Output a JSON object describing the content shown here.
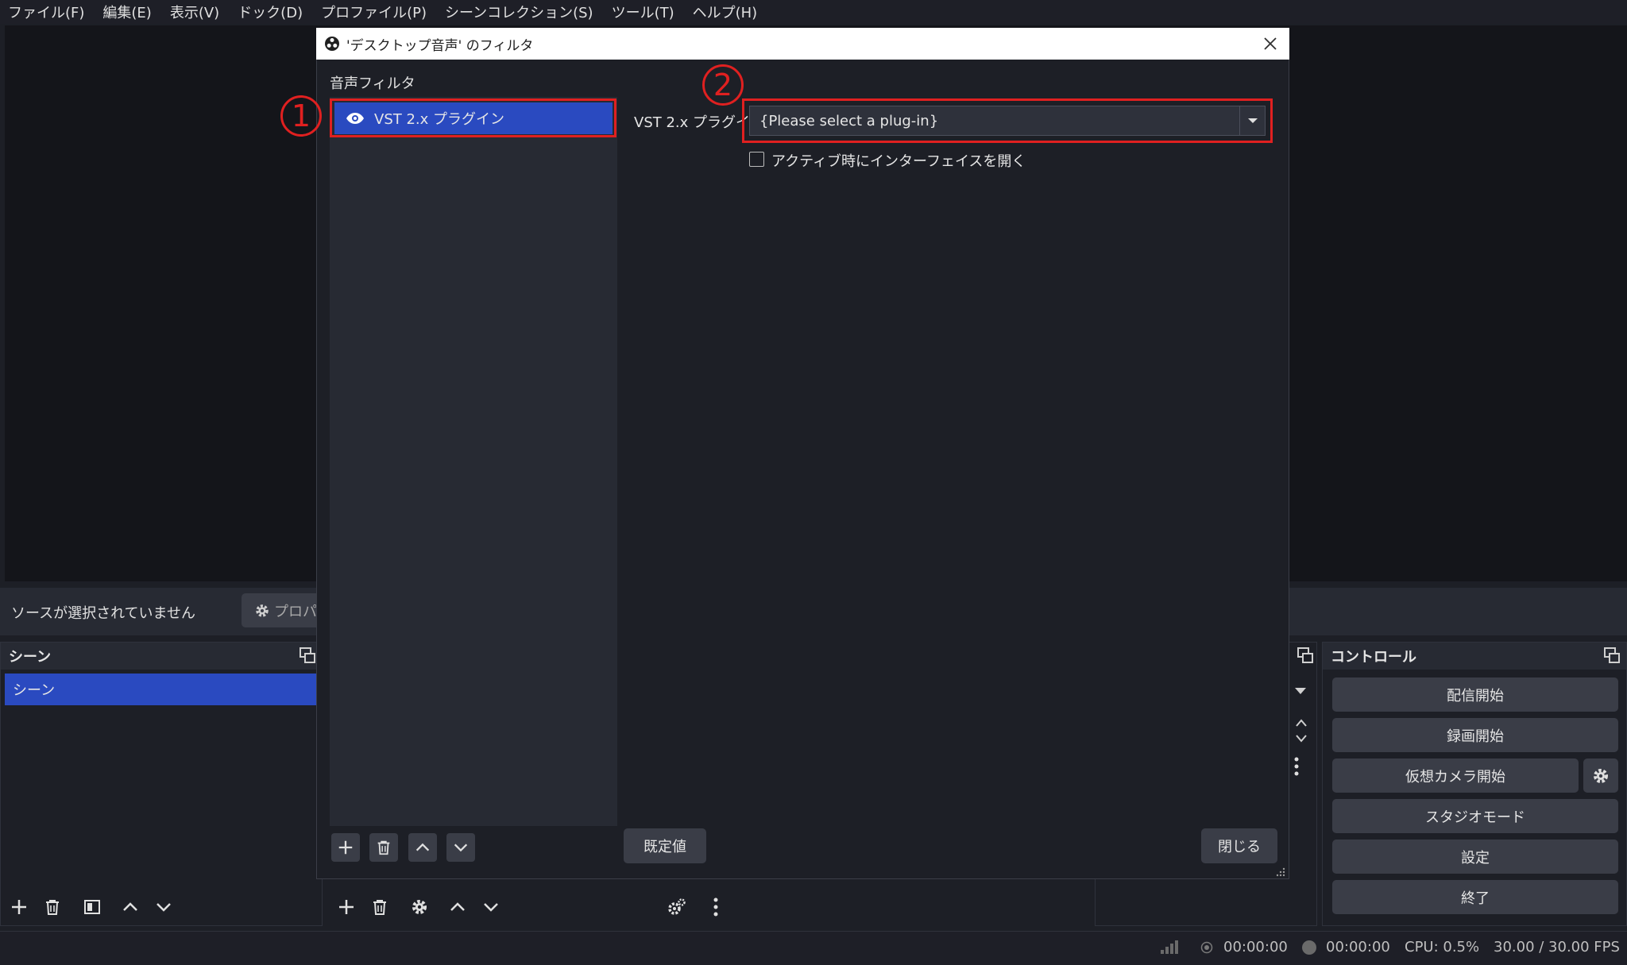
{
  "menubar": {
    "items": [
      "ファイル(F)",
      "編集(E)",
      "表示(V)",
      "ドック(D)",
      "プロファイル(P)",
      "シーンコレクション(S)",
      "ツール(T)",
      "ヘルプ(H)"
    ]
  },
  "source_bar": {
    "no_source": "ソースが選択されていません",
    "properties": "プロパテ"
  },
  "scene_dock": {
    "title": "シーン",
    "items": [
      "シーン"
    ]
  },
  "control_dock": {
    "title": "コントロール",
    "buttons": [
      "配信開始",
      "録画開始",
      "仮想カメラ開始",
      "スタジオモード",
      "設定",
      "終了"
    ]
  },
  "status": {
    "stream_time": "00:00:00",
    "record_time": "00:00:00",
    "cpu": "CPU: 0.5%",
    "fps": "30.00 / 30.00 FPS"
  },
  "dialog": {
    "title": "'デスクトップ音声' のフィルタ",
    "audio_filters_label": "音声フィルタ",
    "filters": [
      "VST 2.x プラグイン"
    ],
    "plugin_label": "VST 2.x プラグイン",
    "plugin_select_value": "{Please select a plug-in}",
    "open_interface_label": "アクティブ時にインターフェイスを開く",
    "defaults_button": "既定値",
    "close_button": "閉じる",
    "markers": [
      "1",
      "2"
    ]
  },
  "colors": {
    "accent": "#2a4ac0",
    "highlight": "#e02020",
    "background": "#1d1f26"
  }
}
